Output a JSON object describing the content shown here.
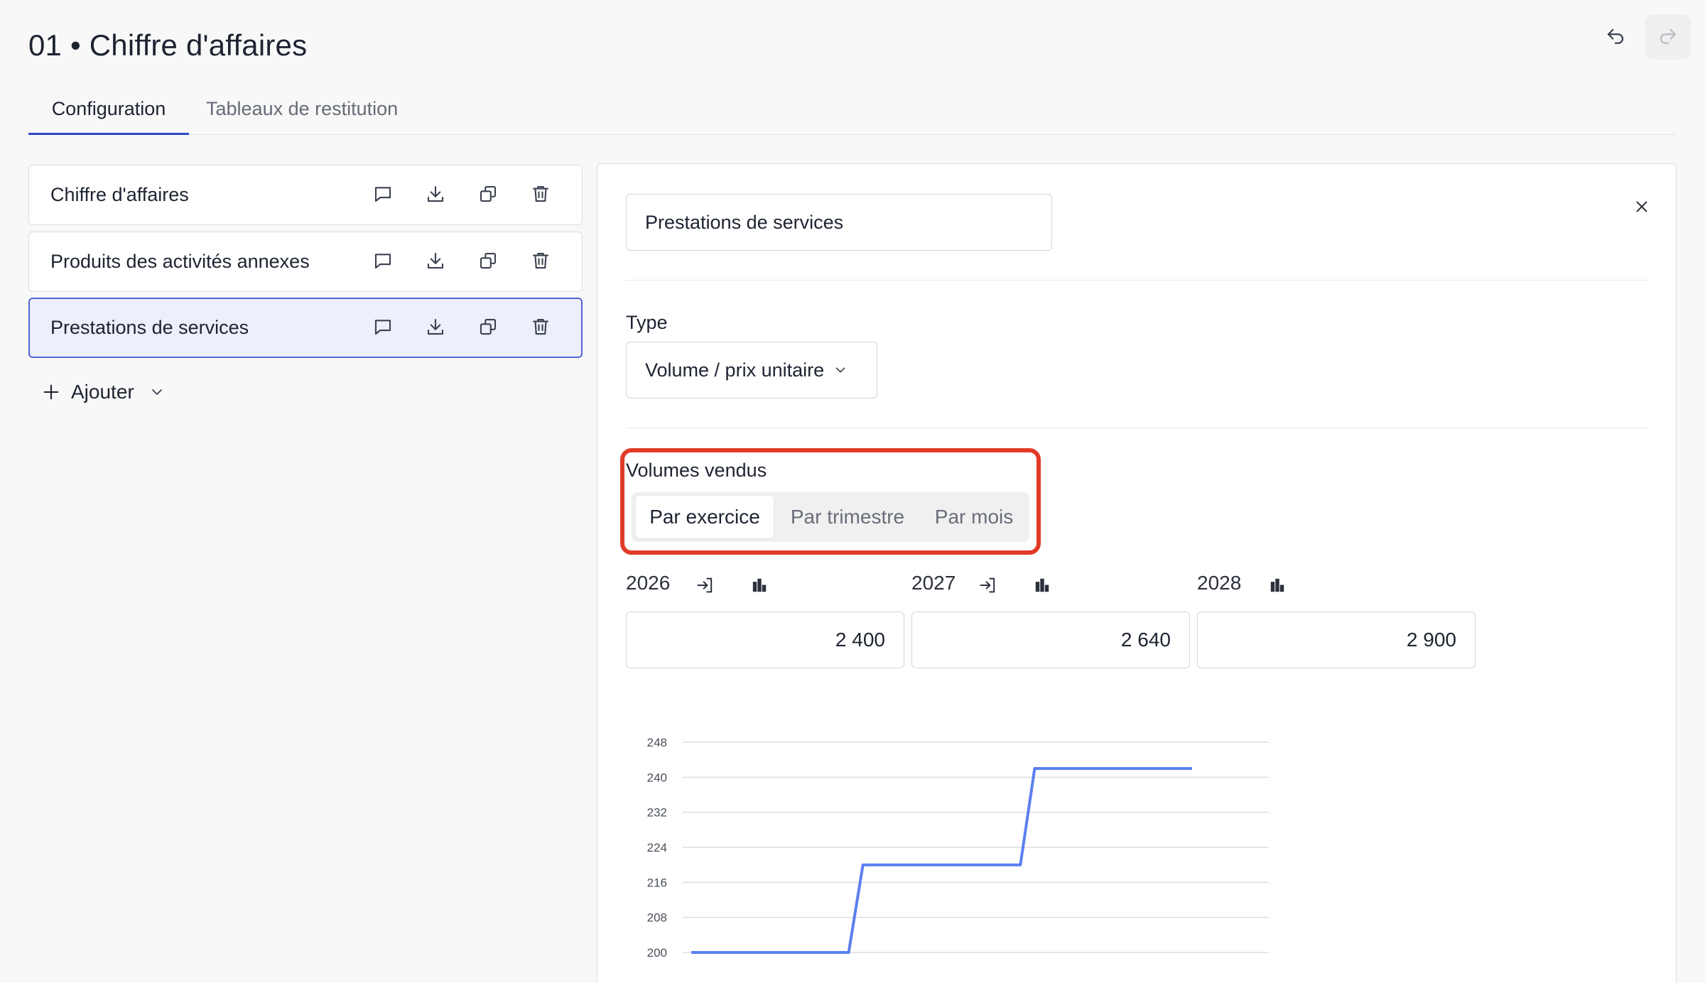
{
  "header": {
    "title": "01 • Chiffre d'affaires",
    "undo_icon": "undo-icon",
    "redo_icon": "redo-icon"
  },
  "tabs": [
    {
      "label": "Configuration",
      "active": true
    },
    {
      "label": "Tableaux de restitution",
      "active": false
    }
  ],
  "list": {
    "items": [
      {
        "label": "Chiffre d'affaires",
        "selected": false
      },
      {
        "label": "Produits des activités annexes",
        "selected": false
      },
      {
        "label": "Prestations de services",
        "selected": true
      }
    ],
    "row_icons": [
      "comment-icon",
      "download-icon",
      "duplicate-icon",
      "trash-icon"
    ],
    "add_label": "Ajouter"
  },
  "detail": {
    "name_value": "Prestations de services",
    "type_label": "Type",
    "type_value": "Volume / prix unitaire",
    "volumes_label": "Volumes vendus",
    "segments": [
      {
        "label": "Par exercice",
        "active": true
      },
      {
        "label": "Par trimestre",
        "active": false
      },
      {
        "label": "Par mois",
        "active": false
      }
    ],
    "years": [
      {
        "year": "2026",
        "value": "2 400",
        "icons": [
          "import-icon",
          "bar-chart-icon"
        ]
      },
      {
        "year": "2027",
        "value": "2 640",
        "icons": [
          "import-icon",
          "bar-chart-icon"
        ]
      },
      {
        "year": "2028",
        "value": "2 900",
        "icons": [
          "bar-chart-icon"
        ]
      }
    ]
  },
  "colors": {
    "accent": "#2f48c6",
    "selected_bg": "#eceffc",
    "highlight": "#e13a26",
    "series": "#5b7ff0"
  },
  "chart_data": {
    "type": "line",
    "step": true,
    "title": "",
    "xlabel": "",
    "ylabel": "",
    "y_ticks": [
      200,
      208,
      216,
      224,
      232,
      240,
      248
    ],
    "ylim": [
      200,
      248
    ],
    "grid": true,
    "series": [
      {
        "values": [
          200,
          200,
          200,
          200,
          200,
          200,
          200,
          200,
          200,
          200,
          200,
          200,
          220,
          220,
          220,
          220,
          220,
          220,
          220,
          220,
          220,
          220,
          220,
          220,
          242,
          242,
          242,
          242,
          242,
          242,
          242,
          242,
          242,
          242,
          242,
          242
        ]
      }
    ]
  }
}
